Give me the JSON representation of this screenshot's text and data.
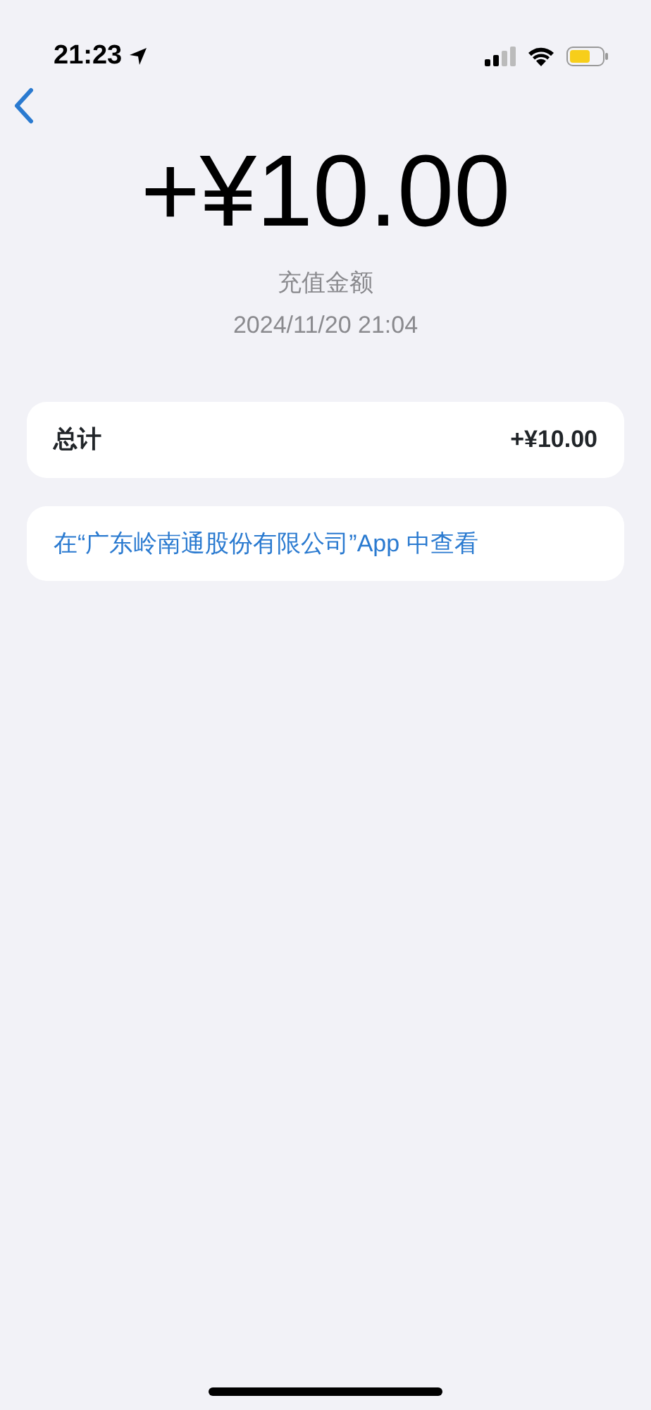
{
  "status_bar": {
    "time": "21:23"
  },
  "amount": "+¥10.00",
  "caption": "充值金额",
  "date": "2024/11/20 21:04",
  "total": {
    "label": "总计",
    "value": "+¥10.00"
  },
  "app_link": "在“广东岭南通股份有限公司”App 中查看"
}
